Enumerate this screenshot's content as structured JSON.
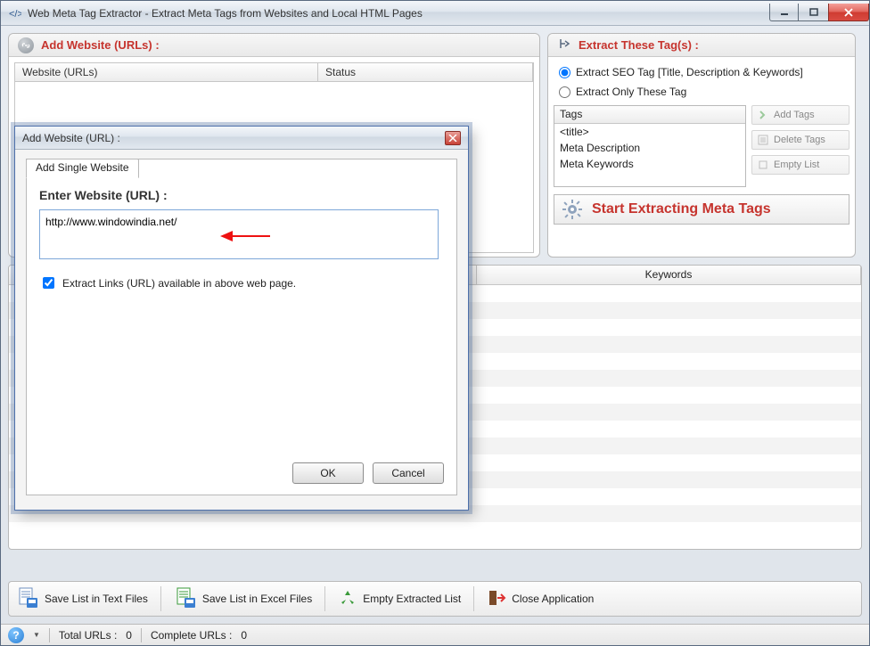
{
  "titlebar": {
    "title": "Web Meta Tag Extractor - Extract Meta Tags from Websites and Local HTML Pages"
  },
  "panel_urls": {
    "title": "Add Website (URLs) :",
    "col_url": "Website (URLs)",
    "col_status": "Status"
  },
  "panel_tags": {
    "title": "Extract These Tag(s) :",
    "radio_seo": "Extract SEO Tag [Title, Description & Keywords]",
    "radio_only": "Extract Only These Tag",
    "list_header": "Tags",
    "items": {
      "t0": "<title>",
      "t1": "Meta Description",
      "t2": "Meta Keywords"
    },
    "btn_add": "Add Tags",
    "btn_del": "Delete Tags",
    "btn_empty": "Empty List",
    "start": "Start Extracting Meta Tags"
  },
  "results": {
    "col_keywords": "Keywords"
  },
  "bottombar": {
    "save_txt": "Save List in Text Files",
    "save_xls": "Save List in Excel Files",
    "empty": "Empty Extracted List",
    "close": "Close Application"
  },
  "statusbar": {
    "total_label": "Total URLs :",
    "total_val": "0",
    "complete_label": "Complete URLs :",
    "complete_val": "0"
  },
  "modal": {
    "title": "Add Website (URL) :",
    "tab": "Add Single Website",
    "label": "Enter Website (URL) :",
    "url_value": "http://www.windowindia.net/",
    "chk": "Extract Links (URL) available in above web page.",
    "ok": "OK",
    "cancel": "Cancel"
  }
}
